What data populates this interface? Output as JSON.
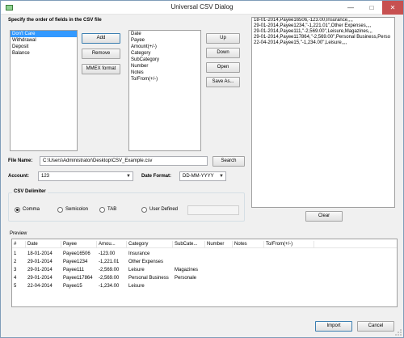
{
  "window": {
    "title": "Universal CSV Dialog"
  },
  "fields": {
    "heading": "Specify the order of fields in the CSV file",
    "available": [
      "Don't Care",
      "Withdrawal",
      "Deposit",
      "Balance"
    ],
    "selected": [
      "Date",
      "Payee",
      "Amount(+/-)",
      "Category",
      "SubCategory",
      "Number",
      "Notes",
      "To/From(+/-)"
    ],
    "add_label": "Add",
    "remove_label": "Remove",
    "mmex_label": "MMEX format",
    "up_label": "Up",
    "down_label": "Down",
    "open_label": "Open",
    "saveas_label": "Save As..."
  },
  "sample_lines": [
    "18-01-2014,Payee16506,-123.00,Insurance,,,,",
    "29-01-2014,Payee1234,\"-1,221.01\",Other Expenses,,,,",
    "29-01-2014,Payee111,\"-2,569.00\",Leisure,Magazines,,,",
    "29-01-2014,Payee117864,\"-2,569.00\",Personal Business,Perso",
    "22-04-2014,Payee15,\"-1,234.00\",Leisure,,,,"
  ],
  "clear_label": "Clear",
  "file": {
    "label": "File Name:",
    "value": "C:\\Users\\Administrator\\Desktop\\CSV_Example.csv",
    "search_label": "Search"
  },
  "account": {
    "label": "Account:",
    "value": "123"
  },
  "date_format": {
    "label": "Date Format:",
    "value": "DD-MM-YYYY"
  },
  "delimiter": {
    "title": "CSV Delimiter",
    "options": [
      "Comma",
      "Semicolon",
      "TAB",
      "User Defined"
    ],
    "selected": "Comma",
    "user_value": ""
  },
  "preview": {
    "title": "Preview",
    "columns": [
      "#",
      "Date",
      "Payee",
      "Amou...",
      "Category",
      "SubCate...",
      "Number",
      "Notes",
      "To/From(+/-)"
    ],
    "rows": [
      [
        "1",
        "18-01-2014",
        "Payee16506",
        "-123.00",
        "Insurance",
        "",
        "",
        "",
        ""
      ],
      [
        "2",
        "29-01-2014",
        "Payee1234",
        "-1,221.01",
        "Other Expenses",
        "",
        "",
        "",
        ""
      ],
      [
        "3",
        "29-01-2014",
        "Payee111",
        "-2,569.00",
        "Leisure",
        "Magazines",
        "",
        "",
        ""
      ],
      [
        "4",
        "29-01-2014",
        "Payee117864",
        "-2,569.00",
        "Personal Business",
        "Personale",
        "",
        "",
        ""
      ],
      [
        "5",
        "22-04-2014",
        "Payee15",
        "-1,234.00",
        "Leisure",
        "",
        "",
        "",
        ""
      ]
    ]
  },
  "import_label": "Import",
  "cancel_label": "Cancel"
}
